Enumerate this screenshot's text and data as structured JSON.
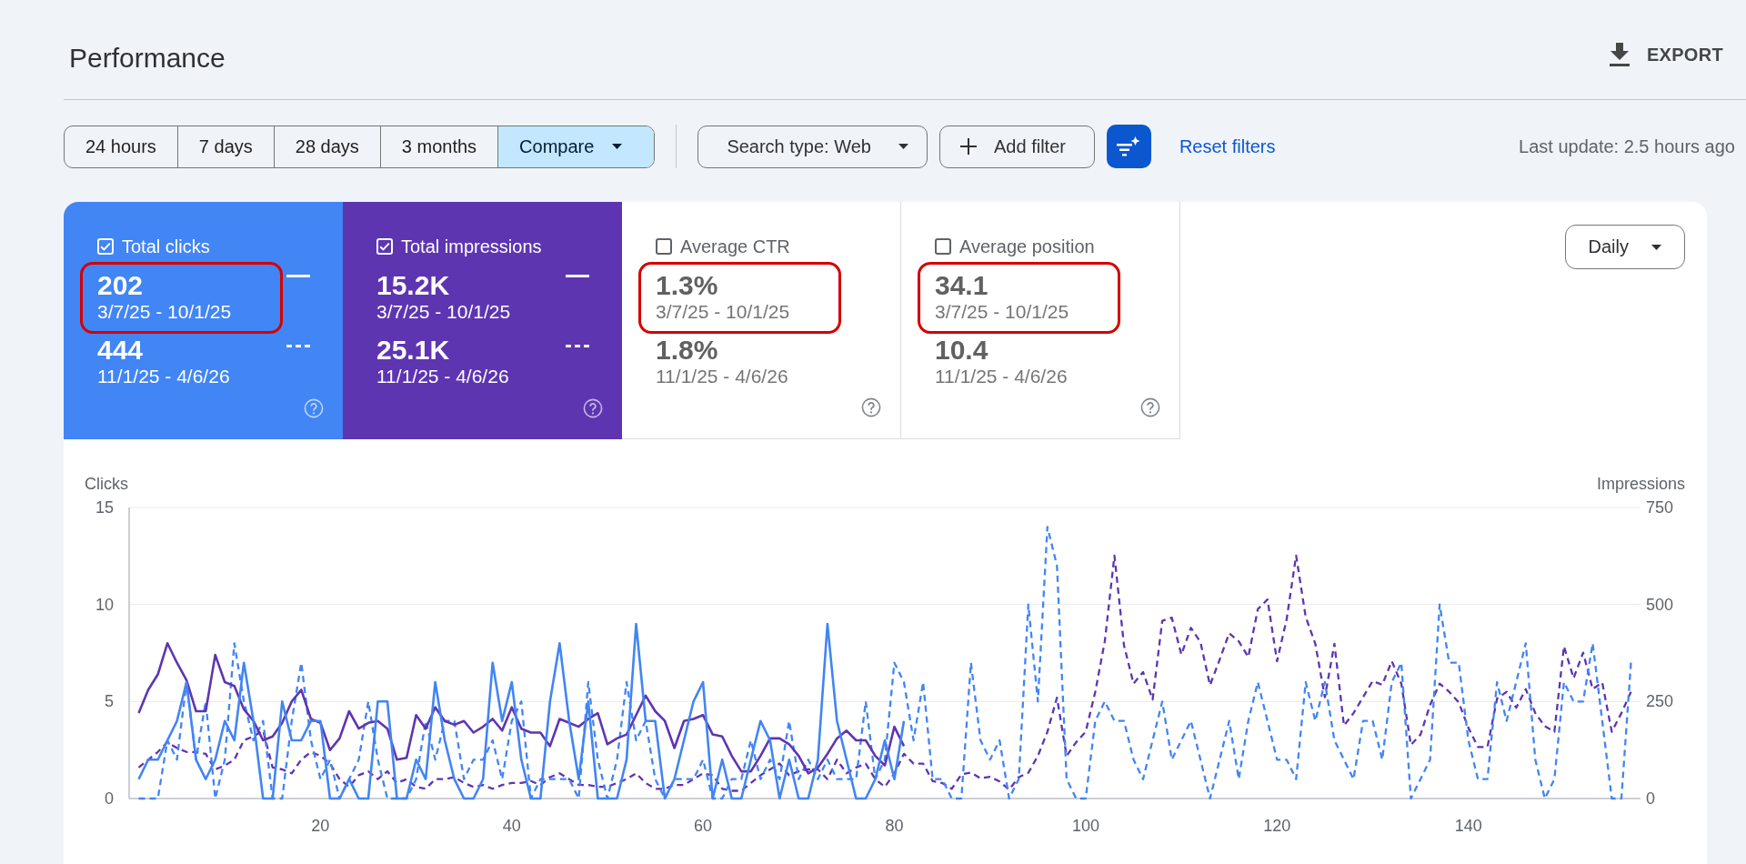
{
  "page": {
    "title": "Performance",
    "export_label": "EXPORT"
  },
  "filters": {
    "date_ranges": [
      {
        "label": "24 hours",
        "kind": "preset",
        "selected": false
      },
      {
        "label": "7 days",
        "kind": "preset",
        "selected": false
      },
      {
        "label": "28 days",
        "kind": "preset",
        "selected": false
      },
      {
        "label": "3 months",
        "kind": "preset",
        "selected": false
      },
      {
        "label": "Compare",
        "kind": "menu",
        "selected": true
      }
    ],
    "search_type": {
      "label": "Search type: Web"
    },
    "add_filter": {
      "label": "Add filter"
    },
    "reset_label": "Reset filters",
    "last_update": "Last update: 2.5 hours ago"
  },
  "metrics": [
    {
      "label": "Total clicks",
      "checked": true,
      "color": "#4285f4",
      "highlighted": true,
      "current": {
        "value": "202",
        "range": "3/7/25 - 10/1/25"
      },
      "previous": {
        "value": "444",
        "range": "11/1/25 - 4/6/26"
      }
    },
    {
      "label": "Total impressions",
      "checked": true,
      "color": "#5e35b1",
      "highlighted": false,
      "current": {
        "value": "15.2K",
        "range": "3/7/25 - 10/1/25"
      },
      "previous": {
        "value": "25.1K",
        "range": "11/1/25 - 4/6/26"
      }
    },
    {
      "label": "Average CTR",
      "checked": false,
      "highlighted": true,
      "current": {
        "value": "1.3%",
        "range": "3/7/25 - 10/1/25"
      },
      "previous": {
        "value": "1.8%",
        "range": "11/1/25 - 4/6/26"
      }
    },
    {
      "label": "Average position",
      "checked": false,
      "highlighted": true,
      "current": {
        "value": "34.1",
        "range": "3/7/25 - 10/1/25"
      },
      "previous": {
        "value": "10.4",
        "range": "11/1/25 - 4/6/26"
      }
    }
  ],
  "interval": {
    "label": "Daily"
  },
  "chart": {
    "chart_data": {
      "type": "line",
      "ylabel": "Clicks",
      "y2label": "Impressions",
      "x": [
        1,
        2,
        3,
        4,
        5,
        6,
        7,
        8,
        9,
        10,
        11,
        12,
        13,
        14,
        15,
        16,
        17,
        18,
        19,
        20,
        21,
        22,
        23,
        24,
        25,
        26,
        27,
        28,
        29,
        30,
        31,
        32,
        33,
        34,
        35,
        36,
        37,
        38,
        39,
        40,
        41,
        42,
        43,
        44,
        45,
        46,
        47,
        48,
        49,
        50,
        51,
        52,
        53,
        54,
        55,
        56,
        57,
        58,
        59,
        60,
        61,
        62,
        63,
        64,
        65,
        66,
        67,
        68,
        69,
        70,
        71,
        72,
        73,
        74,
        75,
        76,
        77,
        78,
        79,
        80,
        81,
        82,
        83,
        84,
        85,
        86,
        87,
        88,
        89,
        90,
        91,
        92,
        93,
        94,
        95,
        96,
        97,
        98,
        99,
        100,
        101,
        102,
        103,
        104,
        105,
        106,
        107,
        108,
        109,
        110,
        111,
        112,
        113,
        114,
        115,
        116,
        117,
        118,
        119,
        120,
        121,
        122,
        123,
        124,
        125,
        126,
        127,
        128,
        129,
        130,
        131,
        132,
        133,
        134,
        135,
        136,
        137,
        138,
        139,
        140,
        141,
        142,
        143,
        144,
        145,
        146,
        147,
        148,
        149,
        150,
        151,
        152,
        153,
        154,
        155,
        156,
        157
      ],
      "xlim": [
        0,
        158
      ],
      "xticks": [
        20,
        40,
        60,
        80,
        100,
        120,
        140
      ],
      "ylim": [
        0,
        15
      ],
      "yticks": [
        0,
        5,
        10,
        15
      ],
      "y2lim": [
        0,
        750
      ],
      "y2ticks": [
        0,
        250,
        500,
        750
      ],
      "series": [
        {
          "color": "#4285f4",
          "values": [
            1,
            2,
            2,
            3,
            4,
            6,
            2,
            1,
            2,
            4,
            3,
            7,
            4,
            0,
            0,
            5,
            3,
            3,
            4,
            4,
            0,
            0,
            1,
            0,
            0,
            5,
            5,
            0,
            0,
            2,
            1,
            6,
            3,
            1,
            0,
            0,
            1,
            7,
            4,
            6,
            2,
            0,
            0,
            5,
            8,
            4,
            1,
            5,
            0,
            0,
            0,
            2,
            9,
            4,
            4,
            0,
            1,
            3,
            5,
            6,
            0,
            2,
            0,
            0,
            2,
            4,
            3,
            0,
            2,
            0,
            0,
            2,
            9,
            4,
            2,
            0,
            0,
            1,
            3,
            1,
            4,
            null,
            null,
            null,
            null,
            null,
            null,
            null,
            null,
            null,
            null,
            null,
            null,
            null,
            null,
            null,
            null,
            null,
            null,
            null,
            null,
            null,
            null,
            null,
            null,
            null,
            null,
            null,
            null,
            null,
            null,
            null,
            null,
            null,
            null,
            null,
            null,
            null,
            null,
            null,
            null,
            null,
            null,
            null,
            null,
            null,
            null,
            null,
            null,
            null,
            null,
            null,
            null,
            null,
            null,
            null,
            null,
            null,
            null,
            null,
            null,
            null,
            null,
            null,
            null,
            null,
            null,
            null,
            null,
            null,
            null,
            null,
            null,
            null,
            null,
            null,
            null
          ]
        },
        {
          "color": "#5e35b1",
          "axis": "y2",
          "values": [
            220,
            280,
            320,
            400,
            350,
            305,
            225,
            225,
            370,
            300,
            290,
            230,
            200,
            150,
            160,
            195,
            250,
            280,
            205,
            195,
            125,
            155,
            225,
            180,
            195,
            200,
            180,
            100,
            105,
            215,
            180,
            235,
            200,
            190,
            200,
            170,
            185,
            205,
            175,
            235,
            180,
            170,
            170,
            135,
            205,
            195,
            185,
            205,
            220,
            140,
            155,
            165,
            215,
            265,
            225,
            200,
            130,
            200,
            205,
            215,
            165,
            160,
            110,
            70,
            70,
            110,
            155,
            155,
            140,
            110,
            65,
            80,
            115,
            155,
            175,
            150,
            150,
            110,
            85,
            185,
            135,
            null,
            null,
            null,
            null,
            null,
            null,
            null,
            null,
            null,
            null,
            null,
            null,
            null,
            null,
            null,
            null,
            null,
            null,
            null,
            null,
            null,
            null,
            null,
            null,
            null,
            null,
            null,
            null,
            null,
            null,
            null,
            null,
            null,
            null,
            null,
            null,
            null,
            null,
            null,
            null,
            null,
            null,
            null,
            null,
            null,
            null,
            null,
            null,
            null,
            null,
            null,
            null,
            null,
            null,
            null,
            null,
            null,
            null,
            null,
            null,
            null,
            null,
            null,
            null,
            null,
            null,
            null,
            null,
            null,
            null,
            null,
            null,
            null,
            null,
            null,
            null
          ]
        },
        {
          "color": "#4285f4",
          "line_style": "dashed",
          "values": [
            0,
            0,
            0,
            3,
            2,
            6,
            2,
            5,
            0,
            2,
            8,
            5,
            3,
            4,
            0,
            0,
            4,
            7,
            3,
            1,
            2,
            0,
            1,
            2,
            5,
            2,
            0,
            0,
            0,
            1,
            4,
            2,
            4,
            4,
            1,
            2,
            2,
            3,
            1,
            4,
            5,
            0,
            1,
            1,
            1,
            1,
            0,
            6,
            2,
            0,
            2,
            6,
            3,
            4,
            1,
            0,
            1,
            1,
            1,
            2,
            0,
            0,
            1,
            1,
            3,
            1,
            2,
            1,
            4,
            1,
            2,
            1,
            2,
            1,
            1,
            1,
            5,
            1,
            2,
            7,
            6,
            3,
            6,
            1,
            1,
            0,
            0,
            7,
            3,
            2,
            3,
            0,
            1,
            10,
            5,
            14,
            12,
            1,
            0,
            0,
            4,
            5,
            4,
            4,
            2,
            1,
            3,
            5,
            2,
            3,
            4,
            2,
            0,
            2,
            4,
            1,
            4,
            6,
            4,
            2,
            2,
            1,
            6,
            4,
            6,
            3,
            2,
            1,
            4,
            4,
            2,
            6,
            7,
            0,
            1,
            2,
            10,
            7,
            7,
            3,
            1,
            1,
            6,
            4,
            6,
            8,
            2,
            0,
            1,
            6,
            5,
            5,
            8,
            4,
            0,
            0,
            7
          ]
        },
        {
          "color": "#5e35b1",
          "axis": "y2",
          "line_style": "dashed",
          "values": [
            80,
            100,
            120,
            145,
            130,
            120,
            120,
            115,
            75,
            85,
            100,
            150,
            160,
            175,
            80,
            75,
            65,
            100,
            120,
            110,
            90,
            50,
            30,
            60,
            70,
            50,
            70,
            40,
            50,
            30,
            25,
            50,
            50,
            55,
            40,
            30,
            35,
            25,
            35,
            40,
            40,
            45,
            35,
            55,
            65,
            50,
            35,
            35,
            30,
            30,
            40,
            50,
            65,
            40,
            25,
            25,
            35,
            35,
            50,
            65,
            60,
            25,
            20,
            20,
            40,
            60,
            75,
            90,
            60,
            70,
            75,
            75,
            50,
            100,
            65,
            80,
            90,
            50,
            30,
            65,
            115,
            90,
            90,
            45,
            40,
            25,
            62,
            67,
            52,
            56,
            44,
            23,
            55,
            66,
            110,
            172,
            260,
            110,
            145,
            172,
            275,
            405,
            626,
            395,
            296,
            326,
            255,
            458,
            466,
            371,
            440,
            403,
            292,
            358,
            426,
            405,
            365,
            488,
            513,
            354,
            461,
            626,
            468,
            399,
            261,
            399,
            188,
            220,
            261,
            303,
            293,
            354,
            296,
            138,
            165,
            241,
            296,
            275,
            248,
            182,
            133,
            133,
            257,
            275,
            234,
            282,
            220,
            186,
            172,
            392,
            310,
            376,
            282,
            299,
            172,
            220,
            275
          ]
        }
      ]
    }
  }
}
